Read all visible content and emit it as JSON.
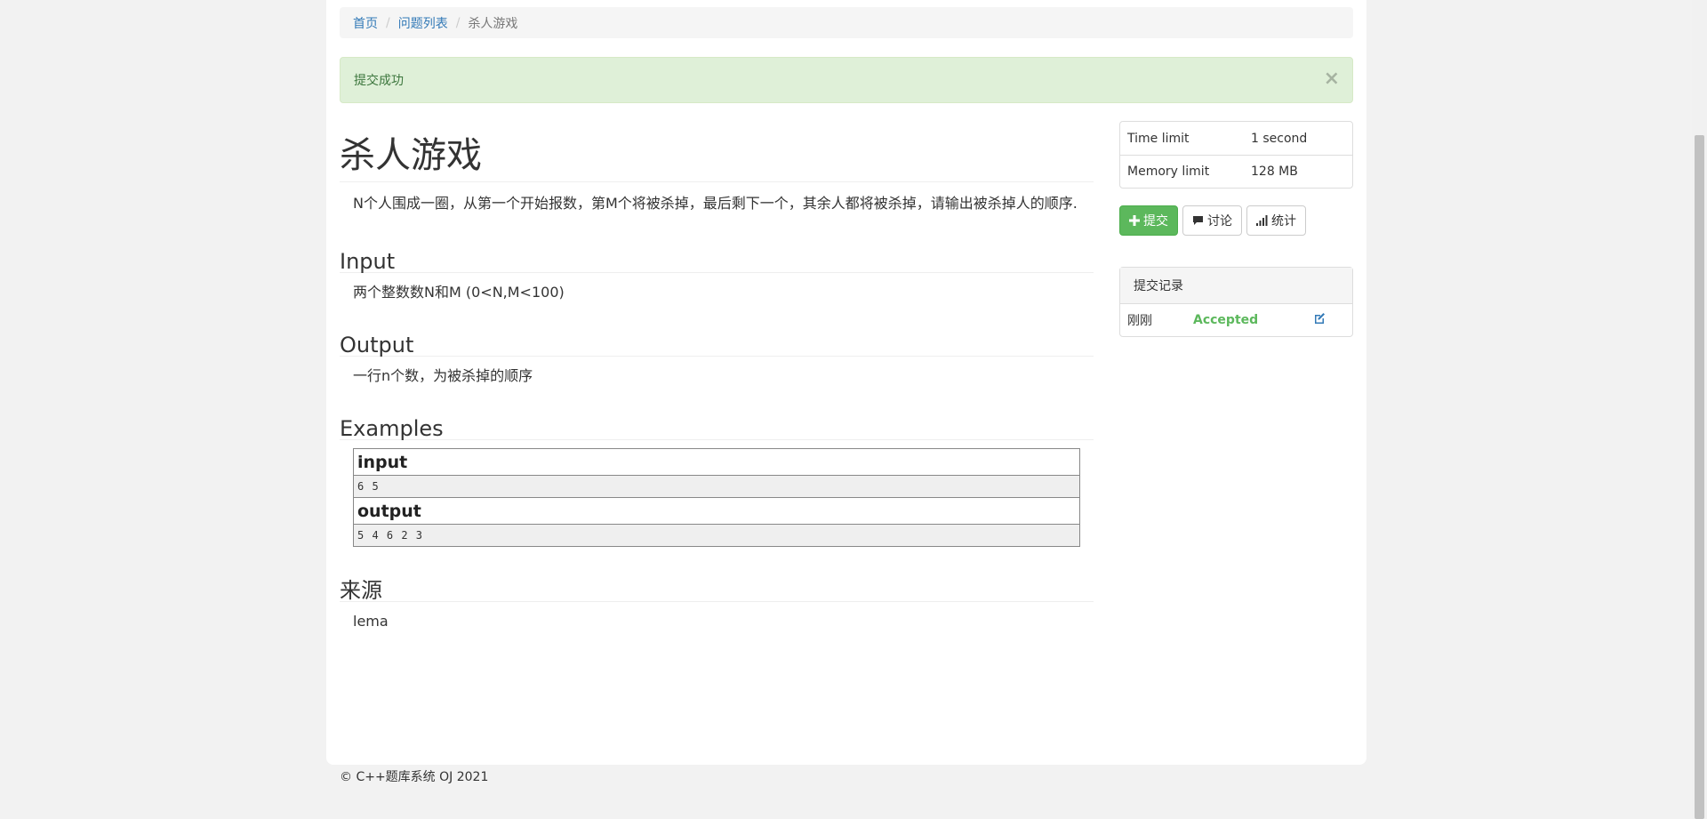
{
  "breadcrumb": {
    "home": "首页",
    "problems": "问题列表",
    "current": "杀人游戏",
    "separator": "/"
  },
  "alert": {
    "message": "提交成功",
    "close_label": "×"
  },
  "problem": {
    "title": "杀人游戏",
    "description": "N个人围成一圈，从第一个开始报数，第M个将被杀掉，最后剩下一个，其余人都将被杀掉，请输出被杀掉人的顺序.",
    "input_heading": "Input",
    "input_text": "两个整数数N和M (0<N,M<100)",
    "output_heading": "Output",
    "output_text": "一行n个数，为被杀掉的顺序",
    "examples_heading": "Examples",
    "example": {
      "input_label": "input",
      "input_value": "6 5",
      "output_label": "output",
      "output_value": "5 4 6 2 3"
    },
    "source_heading": "来源",
    "source_text": "lema"
  },
  "limits": {
    "time_label": "Time limit",
    "time_value": "1 second",
    "memory_label": "Memory limit",
    "memory_value": "128 MB"
  },
  "actions": {
    "submit": "提交",
    "discuss": "讨论",
    "stats": "统计"
  },
  "submissions": {
    "heading": "提交记录",
    "items": [
      {
        "time": "刚刚",
        "status": "Accepted"
      }
    ]
  },
  "footer": {
    "text": "© C++题库系统 OJ 2021"
  },
  "colors": {
    "link": "#337ab7",
    "success": "#5cb85c",
    "alert_bg": "#dff0d8",
    "alert_text": "#3c763d"
  },
  "icons": {
    "submit": "plus-icon",
    "discuss": "comment-icon",
    "stats": "signal-icon",
    "edit": "edit-icon"
  }
}
